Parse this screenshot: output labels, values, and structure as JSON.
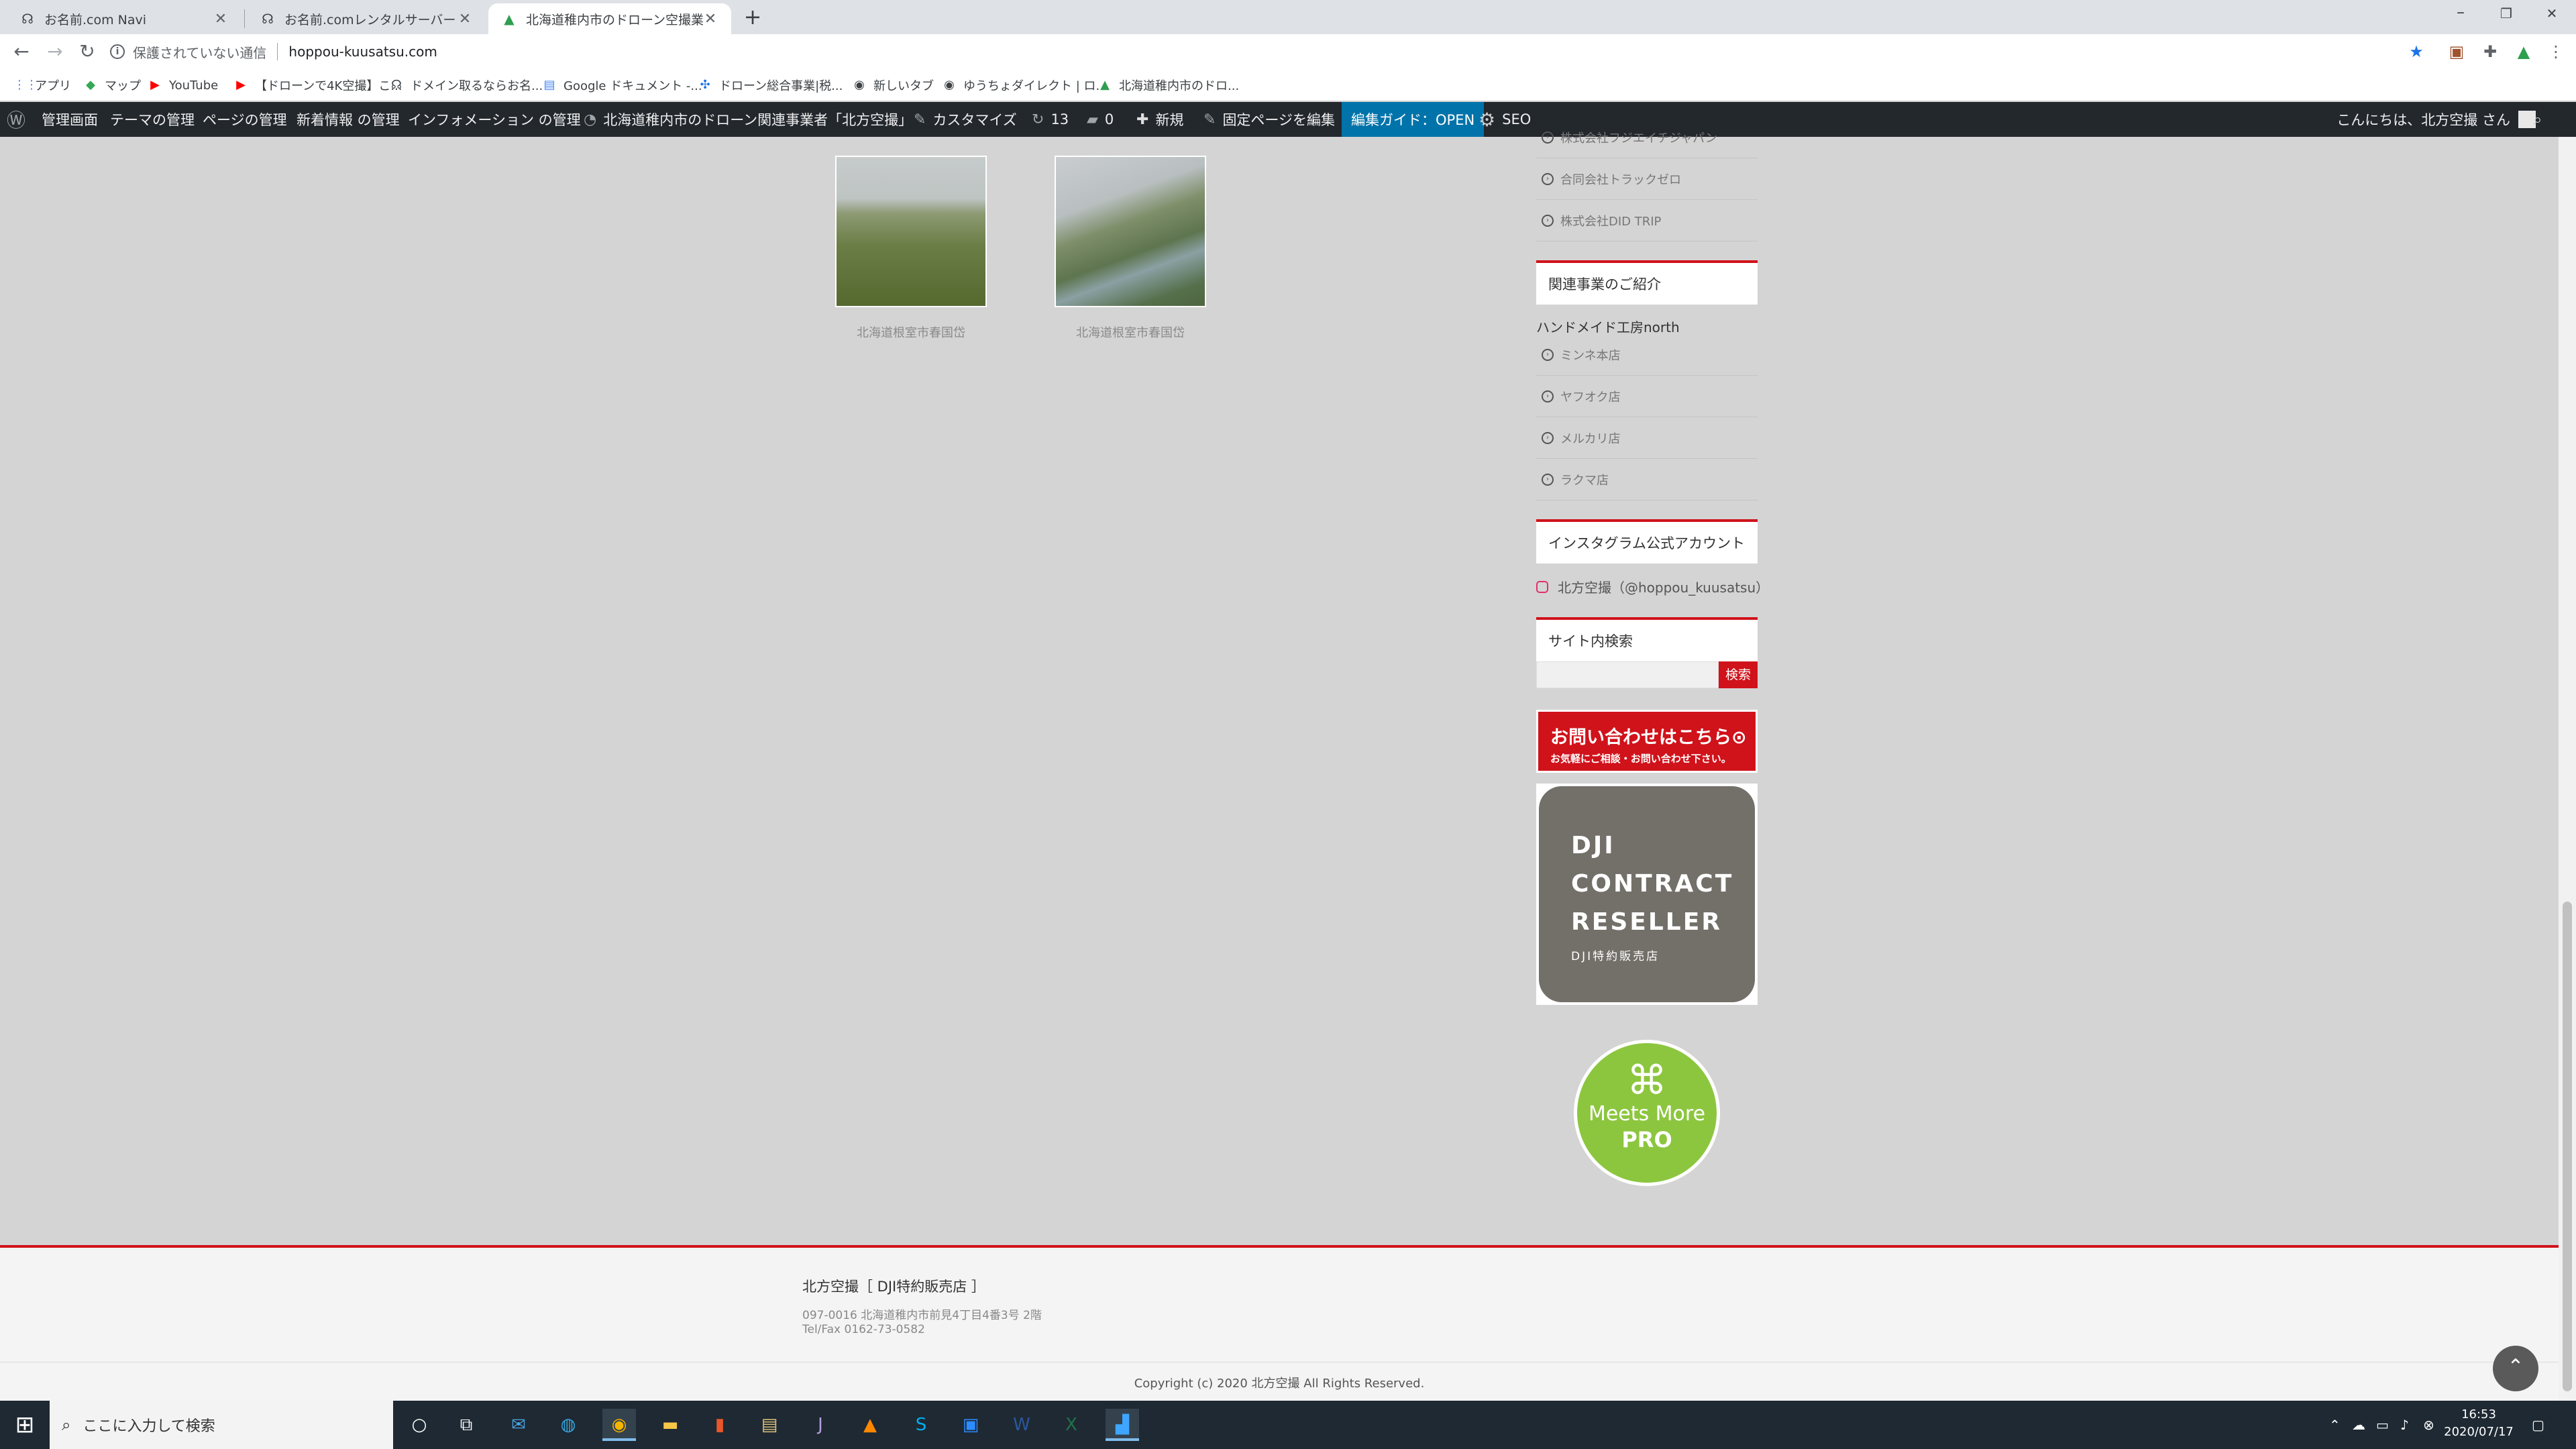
{
  "browser": {
    "tabs": [
      {
        "label": "お名前.com Navi",
        "close": "✕"
      },
      {
        "label": "お名前.comレンタルサーバー コントロ",
        "close": "✕"
      },
      {
        "label": "北海道稚内市のドローン空撮業者「",
        "close": "✕"
      }
    ],
    "new_tab": "+",
    "window": {
      "minimize": "–",
      "restore": "❐",
      "close": "✕"
    },
    "nav": {
      "back": "←",
      "forward": "→",
      "reload": "↻"
    },
    "address": {
      "security_text": "保護されていない通信",
      "url": "hoppou-kuusatsu.com"
    },
    "bookmarks": [
      "アプリ",
      "マップ",
      "YouTube",
      "【ドローンで4K空撮】こ...",
      "ドメイン取るならお名...",
      "Google ドキュメント -...",
      "ドローン総合事業|税...",
      "新しいタブ",
      "ゆうちょダイレクト | ロ...",
      "北海道稚内市のドロ..."
    ]
  },
  "adminbar": {
    "items": [
      "管理画面",
      "テーマの管理",
      "ページの管理",
      "新着情報 の管理",
      "インフォメーション の管理",
      "北海道稚内市のドローン関連事業者「北方空撮」",
      "カスタマイズ",
      "13",
      "0",
      "新規",
      "固定ページを編集",
      "編集ガイド：OPEN",
      "SEO"
    ],
    "greeting": "こんにちは、北方空撮 さん"
  },
  "gallery": [
    {
      "caption": "北海道根室市春国岱"
    },
    {
      "caption": "北海道根室市春国岱"
    }
  ],
  "sidebar": {
    "partner_links": [
      "株式会社フジエイチジャパン",
      "合同会社トラックゼロ",
      "株式会社DID TRIP"
    ],
    "related": {
      "title": "関連事業のご紹介",
      "subtitle": "ハンドメイド工房north",
      "links": [
        "ミンネ本店",
        "ヤフオク店",
        "メルカリ店",
        "ラクマ店"
      ]
    },
    "instagram": {
      "title": "インスタグラム公式アカウント",
      "account": "北方空撮（@hoppou_kuusatsu）"
    },
    "search": {
      "title": "サイト内検索",
      "button": "検索",
      "placeholder": ""
    },
    "contact_banner": {
      "main": "お問い合わせはこちら⊙",
      "sub": "お気軽にご相談・お問い合わせ下さい。"
    },
    "dji_banner": {
      "line1": "DJI",
      "line2": "CONTRACT",
      "line3": "RESELLER",
      "line4": "DJI特約販売店"
    },
    "meets_more": {
      "line1": "Meets More",
      "line2": "PRO"
    }
  },
  "footer": {
    "name": "北方空撮［ DJI特約販売店 ］",
    "address": "097-0016 北海道稚内市前見4丁目4番3号 2階",
    "tel": "Tel/Fax 0162-73-0582",
    "copyright": "Copyright (c) 2020 北方空撮 All Rights Reserved."
  },
  "taskbar": {
    "search_placeholder": "ここに入力して検索",
    "time": "16:53",
    "date": "2020/07/17"
  }
}
